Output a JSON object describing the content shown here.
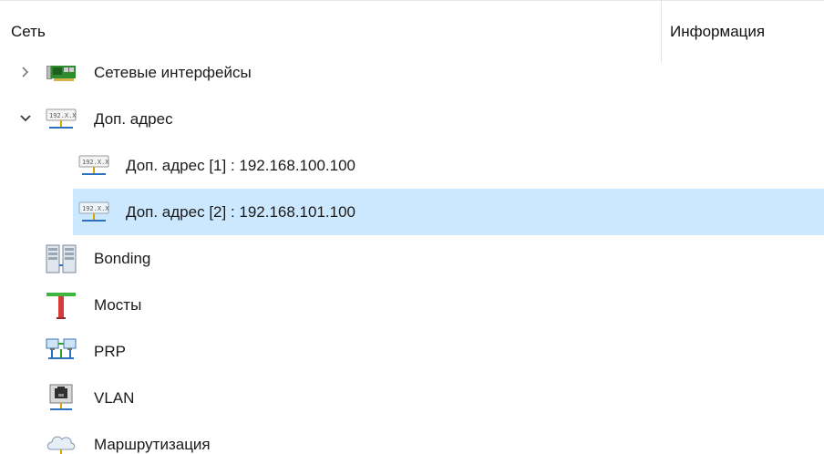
{
  "header": {
    "name_column": "Сеть",
    "info_column": "Информация"
  },
  "tree": {
    "items": [
      {
        "label": "Сетевые интерфейсы",
        "icon": "network-card-icon",
        "expanded": false,
        "has_children": true
      },
      {
        "label": "Доп. адрес",
        "icon": "ip-address-icon",
        "expanded": true,
        "has_children": true
      },
      {
        "label": "Доп. адрес [1] : 192.168.100.100",
        "icon": "ip-address-icon",
        "selected": false
      },
      {
        "label": "Доп. адрес [2] : 192.168.101.100",
        "icon": "ip-address-icon",
        "selected": true
      },
      {
        "label": "Bonding",
        "icon": "bonding-servers-icon"
      },
      {
        "label": "Мосты",
        "icon": "bridge-icon"
      },
      {
        "label": "PRP",
        "icon": "prp-network-icon"
      },
      {
        "label": "VLAN",
        "icon": "vlan-port-icon"
      },
      {
        "label": "Маршрутизация",
        "icon": "routing-cloud-icon"
      }
    ]
  },
  "colors": {
    "selection": "#cce8ff",
    "grid": "#e5e5e5"
  }
}
